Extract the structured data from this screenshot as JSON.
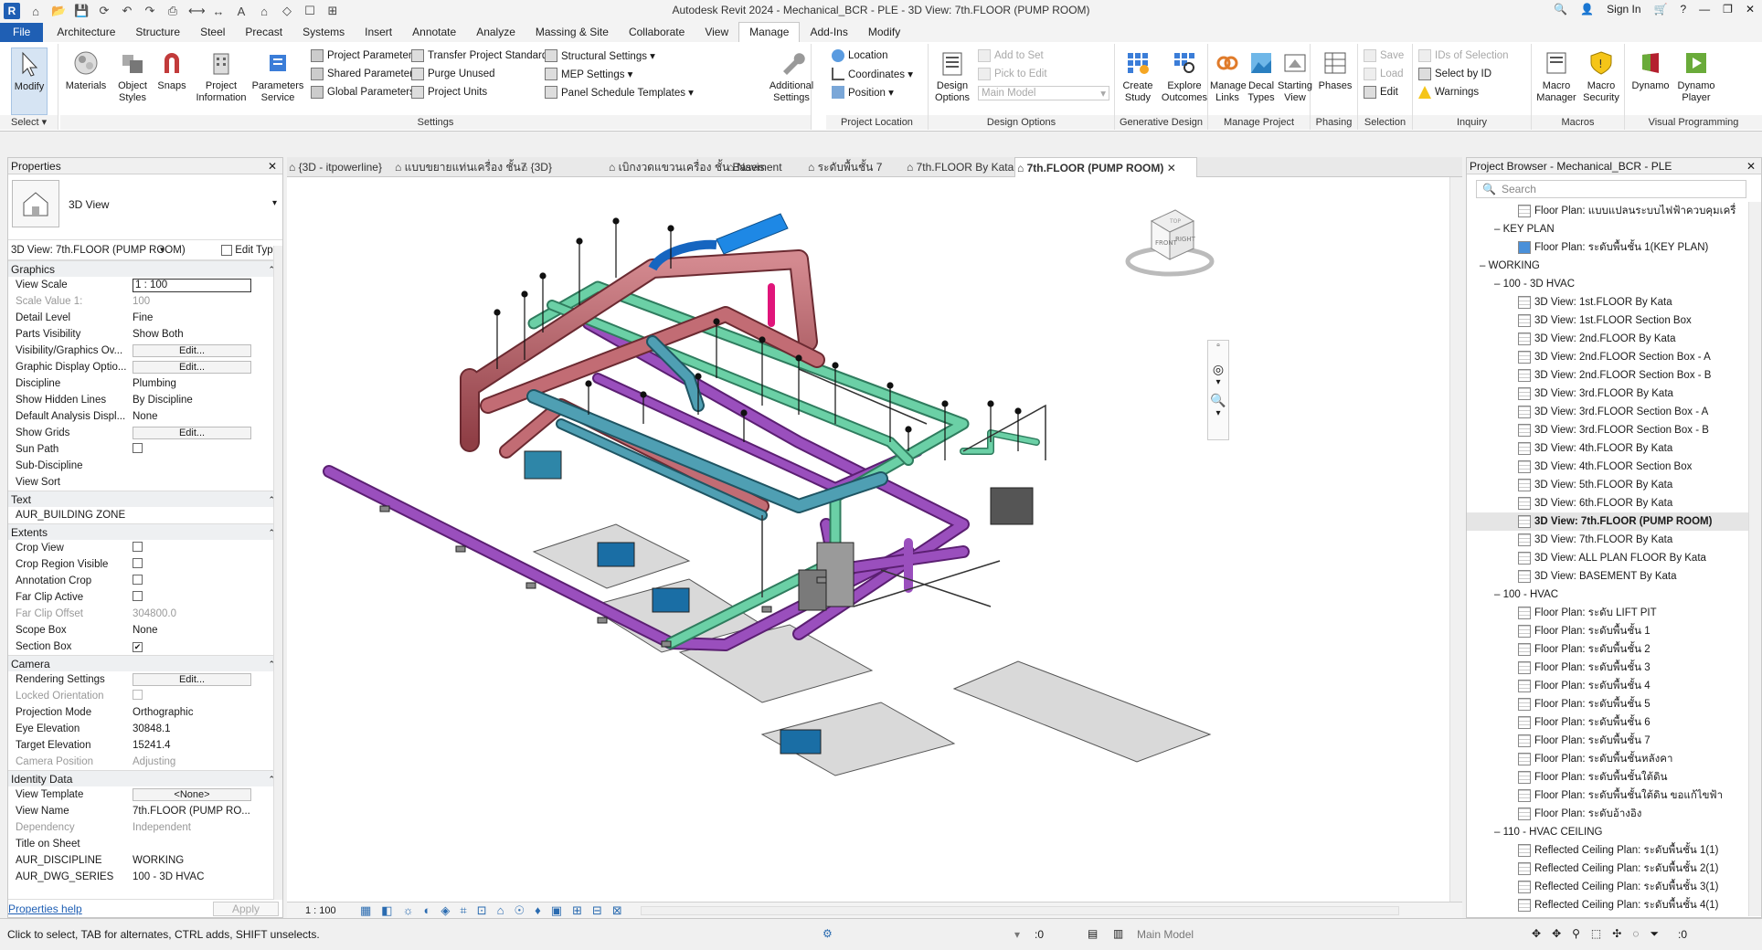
{
  "window": {
    "title": "Autodesk Revit 2024 - Mechanical_BCR - PLE - 3D View: 7th.FLOOR (PUMP ROOM)",
    "sign_in": "Sign In"
  },
  "tabs": [
    "File",
    "Architecture",
    "Structure",
    "Steel",
    "Precast",
    "Systems",
    "Insert",
    "Annotate",
    "Analyze",
    "Massing & Site",
    "Collaborate",
    "View",
    "Manage",
    "Add-Ins",
    "Modify"
  ],
  "ribbon": {
    "select": {
      "modify": "Modify",
      "label": "Select ▾"
    },
    "settings": {
      "materials": "Materials",
      "object_styles": "Object Styles",
      "snaps": "Snaps",
      "project_information": "Project Information",
      "parameters_service": "Parameters Service",
      "project_parameters": "Project  Parameters",
      "shared_parameters": "Shared  Parameters",
      "global_parameters": "Global  Parameters",
      "transfer": "Transfer  Project Standards",
      "purge": "Purge  Unused",
      "project_units": "Project  Units",
      "structural": "Structural  Settings ▾",
      "mep": "MEP  Settings ▾",
      "panel_schedule": "Panel Schedule  Templates ▾",
      "additional": "Additional Settings",
      "label": "Settings"
    },
    "project_location": {
      "location": "Location",
      "coordinates": "Coordinates ▾",
      "position": "Position ▾",
      "label": "Project Location"
    },
    "design_options": {
      "design_options": "Design Options",
      "add_to_set": "Add to Set",
      "pick_to_edit": "Pick to Edit",
      "main_model": "Main Model",
      "label": "Design Options"
    },
    "generative": {
      "create_study": "Create Study",
      "explore_outcomes": "Explore Outcomes",
      "label": "Generative Design"
    },
    "manage_project": {
      "manage_links": "Manage Links",
      "decal_types": "Decal Types",
      "starting_view": "Starting View",
      "label": "Manage Project"
    },
    "phasing": {
      "phases": "Phases",
      "label": "Phasing"
    },
    "selection": {
      "save": "Save",
      "load": "Load",
      "edit": "Edit",
      "label": "Selection"
    },
    "inquiry": {
      "ids_of_selection": "IDs of  Selection",
      "select_by_id": "Select  by ID",
      "warnings": "Warnings",
      "label": "Inquiry"
    },
    "macros": {
      "macro_manager": "Macro Manager",
      "macro_security": "Macro Security",
      "label": "Macros"
    },
    "visual_programming": {
      "dynamo": "Dynamo",
      "dynamo_player": "Dynamo Player",
      "label": "Visual Programming"
    }
  },
  "properties": {
    "title": "Properties",
    "type_name": "3D View",
    "instance": "3D View: 7th.FLOOR (PUMP ROOM)",
    "edit_type": "Edit Type",
    "sections": {
      "graphics": "Graphics",
      "text": "Text",
      "extents": "Extents",
      "camera": "Camera",
      "identity": "Identity Data"
    },
    "rows": {
      "view_scale": {
        "k": "View Scale",
        "v": "1 : 100"
      },
      "scale_value": {
        "k": "Scale Value    1:",
        "v": "100"
      },
      "detail_level": {
        "k": "Detail Level",
        "v": "Fine"
      },
      "parts_visibility": {
        "k": "Parts Visibility",
        "v": "Show Both"
      },
      "vg": {
        "k": "Visibility/Graphics Ov...",
        "v": "Edit..."
      },
      "gdo": {
        "k": "Graphic Display Optio...",
        "v": "Edit..."
      },
      "discipline": {
        "k": "Discipline",
        "v": "Plumbing"
      },
      "hidden_lines": {
        "k": "Show Hidden Lines",
        "v": "By Discipline"
      },
      "analysis": {
        "k": "Default Analysis Displ...",
        "v": "None"
      },
      "show_grids": {
        "k": "Show Grids",
        "v": "Edit..."
      },
      "sun_path": {
        "k": "Sun Path",
        "v": ""
      },
      "sub_discipline": {
        "k": "Sub-Discipline",
        "v": ""
      },
      "view_sort": {
        "k": "View Sort",
        "v": ""
      },
      "building_zone": {
        "k": "AUR_BUILDING ZONE",
        "v": ""
      },
      "crop_view": {
        "k": "Crop View",
        "v": ""
      },
      "crop_region": {
        "k": "Crop Region Visible",
        "v": ""
      },
      "annotation_crop": {
        "k": "Annotation Crop",
        "v": ""
      },
      "far_clip_active": {
        "k": "Far Clip Active",
        "v": ""
      },
      "far_clip_offset": {
        "k": "Far Clip Offset",
        "v": "304800.0"
      },
      "scope_box": {
        "k": "Scope Box",
        "v": "None"
      },
      "section_box": {
        "k": "Section Box",
        "v": ""
      },
      "rendering": {
        "k": "Rendering Settings",
        "v": "Edit..."
      },
      "locked_orientation": {
        "k": "Locked Orientation",
        "v": ""
      },
      "projection": {
        "k": "Projection Mode",
        "v": "Orthographic"
      },
      "eye_elevation": {
        "k": "Eye Elevation",
        "v": "30848.1"
      },
      "target_elevation": {
        "k": "Target Elevation",
        "v": "15241.4"
      },
      "camera_position": {
        "k": "Camera Position",
        "v": "Adjusting"
      },
      "view_template": {
        "k": "View Template",
        "v": "<None>"
      },
      "view_name": {
        "k": "View Name",
        "v": "7th.FLOOR (PUMP RO..."
      },
      "dependency": {
        "k": "Dependency",
        "v": "Independent"
      },
      "title_on_sheet": {
        "k": "Title on Sheet",
        "v": ""
      },
      "aur_discipline": {
        "k": "AUR_DISCIPLINE",
        "v": "WORKING"
      },
      "aur_dwg_series": {
        "k": "AUR_DWG_SERIES",
        "v": "100 - 3D HVAC"
      }
    },
    "help": "Properties help",
    "apply": "Apply"
  },
  "view_tabs": [
    "{3D - itpowerline}",
    "แบบขยายแท่นเครื่อง ชั้น7",
    "{3D}",
    "เบิกงวดแขวนเครื่อง ชั้น Basement",
    "Navis",
    "ระดับพื้นชั้น 7",
    "7th.FLOOR By Kata",
    "7th.FLOOR (PUMP ROOM)"
  ],
  "view_status": {
    "scale": "1 : 100"
  },
  "viewcube": {
    "front": "FRONT",
    "right": "RIGHT",
    "top": "TOP"
  },
  "browser": {
    "title": "Project Browser - Mechanical_BCR - PLE",
    "search": "Search",
    "items": [
      {
        "t": "Floor Plan: แบบแปลนระบบไฟฟ้าควบคุมเครื่",
        "lvl": 3,
        "icon": "plan"
      },
      {
        "t": "KEY PLAN",
        "lvl": 2,
        "icon": "none"
      },
      {
        "t": "Floor Plan: ระดับพื้นชั้น 1(KEY PLAN)",
        "lvl": 3,
        "icon": "plan-blue"
      },
      {
        "t": "WORKING",
        "lvl": 1,
        "icon": "none"
      },
      {
        "t": "100 - 3D HVAC",
        "lvl": 2,
        "icon": "none"
      },
      {
        "t": "3D View: 1st.FLOOR By Kata",
        "lvl": 3,
        "icon": "plan"
      },
      {
        "t": "3D View: 1st.FLOOR Section Box",
        "lvl": 3,
        "icon": "plan"
      },
      {
        "t": "3D View: 2nd.FLOOR By Kata",
        "lvl": 3,
        "icon": "plan"
      },
      {
        "t": "3D View: 2nd.FLOOR Section Box - A",
        "lvl": 3,
        "icon": "plan"
      },
      {
        "t": "3D View: 2nd.FLOOR Section Box - B",
        "lvl": 3,
        "icon": "plan"
      },
      {
        "t": "3D View: 3rd.FLOOR By Kata",
        "lvl": 3,
        "icon": "plan"
      },
      {
        "t": "3D View: 3rd.FLOOR Section Box - A",
        "lvl": 3,
        "icon": "plan"
      },
      {
        "t": "3D View: 3rd.FLOOR Section Box - B",
        "lvl": 3,
        "icon": "plan"
      },
      {
        "t": "3D View: 4th.FLOOR By Kata",
        "lvl": 3,
        "icon": "plan"
      },
      {
        "t": "3D View: 4th.FLOOR Section Box",
        "lvl": 3,
        "icon": "plan"
      },
      {
        "t": "3D View: 5th.FLOOR By Kata",
        "lvl": 3,
        "icon": "plan"
      },
      {
        "t": "3D View: 6th.FLOOR By Kata",
        "lvl": 3,
        "icon": "plan"
      },
      {
        "t": "3D View: 7th.FLOOR (PUMP ROOM)",
        "lvl": 3,
        "icon": "plan",
        "sel": true
      },
      {
        "t": "3D View: 7th.FLOOR By Kata",
        "lvl": 3,
        "icon": "plan"
      },
      {
        "t": "3D View: ALL PLAN FLOOR By Kata",
        "lvl": 3,
        "icon": "plan"
      },
      {
        "t": "3D View: BASEMENT By Kata",
        "lvl": 3,
        "icon": "plan"
      },
      {
        "t": "100 - HVAC",
        "lvl": 2,
        "icon": "none"
      },
      {
        "t": "Floor Plan: ระดับ LIFT PIT",
        "lvl": 3,
        "icon": "plan"
      },
      {
        "t": "Floor Plan: ระดับพื้นชั้น 1",
        "lvl": 3,
        "icon": "plan"
      },
      {
        "t": "Floor Plan: ระดับพื้นชั้น 2",
        "lvl": 3,
        "icon": "plan"
      },
      {
        "t": "Floor Plan: ระดับพื้นชั้น 3",
        "lvl": 3,
        "icon": "plan"
      },
      {
        "t": "Floor Plan: ระดับพื้นชั้น 4",
        "lvl": 3,
        "icon": "plan"
      },
      {
        "t": "Floor Plan: ระดับพื้นชั้น 5",
        "lvl": 3,
        "icon": "plan"
      },
      {
        "t": "Floor Plan: ระดับพื้นชั้น 6",
        "lvl": 3,
        "icon": "plan"
      },
      {
        "t": "Floor Plan: ระดับพื้นชั้น 7",
        "lvl": 3,
        "icon": "plan"
      },
      {
        "t": "Floor Plan: ระดับพื้นชั้นหลังคา",
        "lvl": 3,
        "icon": "plan"
      },
      {
        "t": "Floor Plan: ระดับพื้นชั้นใต้ดิน",
        "lvl": 3,
        "icon": "plan"
      },
      {
        "t": "Floor Plan: ระดับพื้นชั้นใต้ดิน ขอแก้ไขฟ้า",
        "lvl": 3,
        "icon": "plan"
      },
      {
        "t": "Floor Plan: ระดับอ้างอิง",
        "lvl": 3,
        "icon": "plan"
      },
      {
        "t": "110 - HVAC CEILING",
        "lvl": 2,
        "icon": "none"
      },
      {
        "t": "Reflected Ceiling Plan: ระดับพื้นชั้น 1(1)",
        "lvl": 3,
        "icon": "plan"
      },
      {
        "t": "Reflected Ceiling Plan: ระดับพื้นชั้น 2(1)",
        "lvl": 3,
        "icon": "plan"
      },
      {
        "t": "Reflected Ceiling Plan: ระดับพื้นชั้น 3(1)",
        "lvl": 3,
        "icon": "plan"
      },
      {
        "t": "Reflected Ceiling Plan: ระดับพื้นชั้น 4(1)",
        "lvl": 3,
        "icon": "plan"
      }
    ]
  },
  "status": {
    "hint": "Click to select, TAB for alternates, CTRL adds, SHIFT unselects.",
    "zero": ":0",
    "main_model": "Main Model",
    "filter_count": ":0"
  },
  "colors": {
    "pipe_red": "#b7585f",
    "pipe_green": "#5fbf9a",
    "pipe_purple": "#8e44b0",
    "pipe_teal": "#3f8ea0",
    "duct_blue": "#1e88e5",
    "accent": "#1f5fb4"
  }
}
